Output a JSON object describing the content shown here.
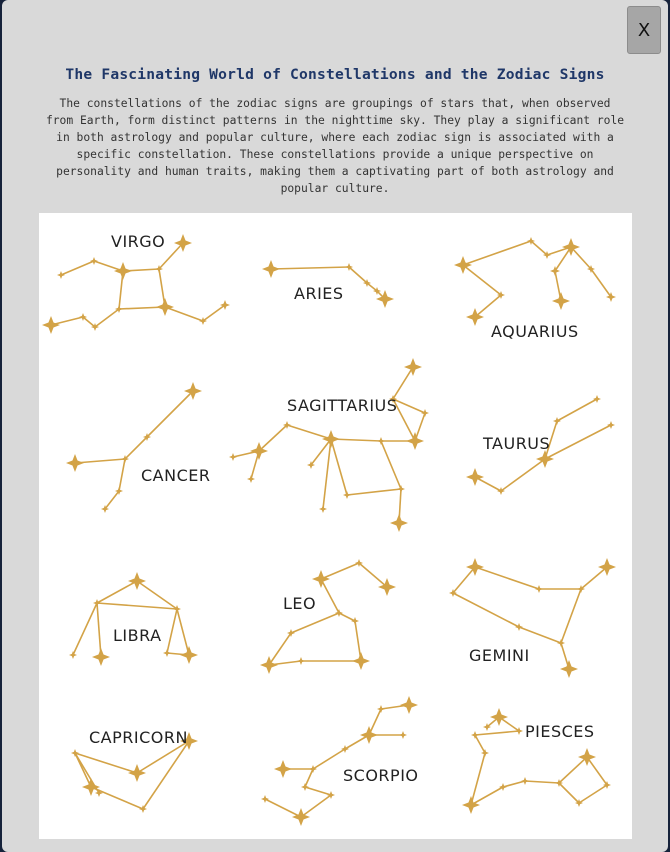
{
  "modal": {
    "close_label": "X",
    "title": "The Fascinating World of Constellations and the Zodiac Signs",
    "description": "The constellations of the zodiac signs are groupings of stars that, when observed from Earth, form distinct patterns in the nighttime sky. They play a significant role in both astrology and popular culture, where each zodiac sign is associated with a specific constellation. These constellations provide a unique perspective on personality and human traits, making them a captivating part of both astrology and popular culture."
  },
  "colors": {
    "star_gold": "#d3a347",
    "title_blue": "#1f3768",
    "modal_bg": "#d9d9d9"
  },
  "constellations": [
    {
      "id": "virgo",
      "label": "VIRGO"
    },
    {
      "id": "aries",
      "label": "ARIES"
    },
    {
      "id": "aquarius",
      "label": "AQUARIUS"
    },
    {
      "id": "cancer",
      "label": "CANCER"
    },
    {
      "id": "sagittarius",
      "label": "SAGITTARIUS"
    },
    {
      "id": "taurus",
      "label": "TAURUS"
    },
    {
      "id": "libra",
      "label": "LIBRA"
    },
    {
      "id": "leo",
      "label": "LEO"
    },
    {
      "id": "gemini",
      "label": "GEMINI"
    },
    {
      "id": "capricorn",
      "label": "CAPRICORN"
    },
    {
      "id": "scorpio",
      "label": "SCORPIO"
    },
    {
      "id": "piesces",
      "label": "PIESCES"
    }
  ]
}
